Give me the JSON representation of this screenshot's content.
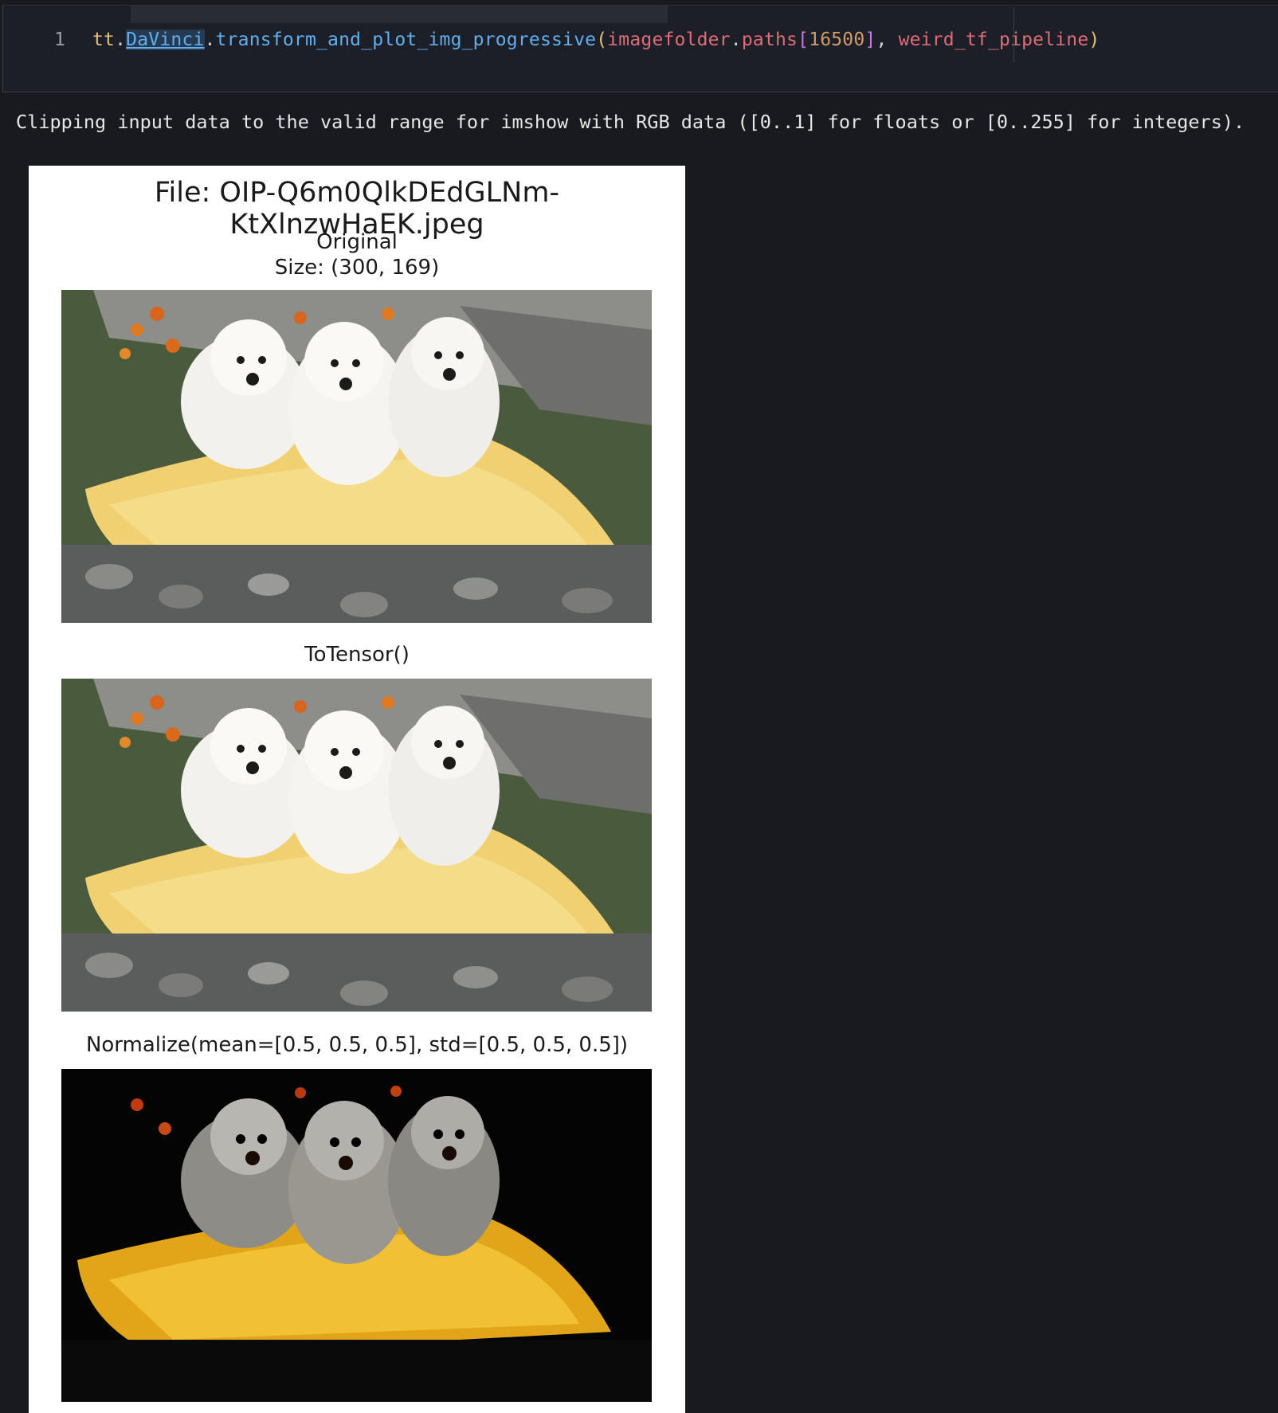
{
  "cell": {
    "line_number": "1",
    "code_tokens": {
      "t1": "tt",
      "t2": ".",
      "t3": "DaVinci",
      "t4": ".",
      "t5": "transform_and_plot_img_progressive",
      "t6": "(",
      "t7": "imagefolder",
      "t8": ".",
      "t9": "paths",
      "t10": "[",
      "t11": "16500",
      "t12": "]",
      "t13": ", ",
      "t14": "weird_tf_pipeline",
      "t15": ")"
    }
  },
  "output": {
    "warning": "Clipping input data to the valid range for imshow with RGB data ([0..1] for floats or [0..255] for integers)."
  },
  "figure": {
    "title": "File: OIP-Q6m0QlkDEdGLNm-KtXlnzwHaEK.jpeg",
    "panels": [
      {
        "title_line1": "Original",
        "title_line2": "Size: (300, 169)",
        "image": "three-white-puppies-on-yellow-blanket"
      },
      {
        "title_line1": "ToTensor()",
        "image": "three-white-puppies-on-yellow-blanket"
      },
      {
        "title_line1": "Normalize(mean=[0.5, 0.5, 0.5], std=[0.5, 0.5, 0.5])",
        "image": "three-white-puppies-normalized-dark"
      }
    ]
  },
  "colors": {
    "background": "#181a1f",
    "cell_bg": "#1c1f27",
    "figure_bg": "#ffffff"
  }
}
